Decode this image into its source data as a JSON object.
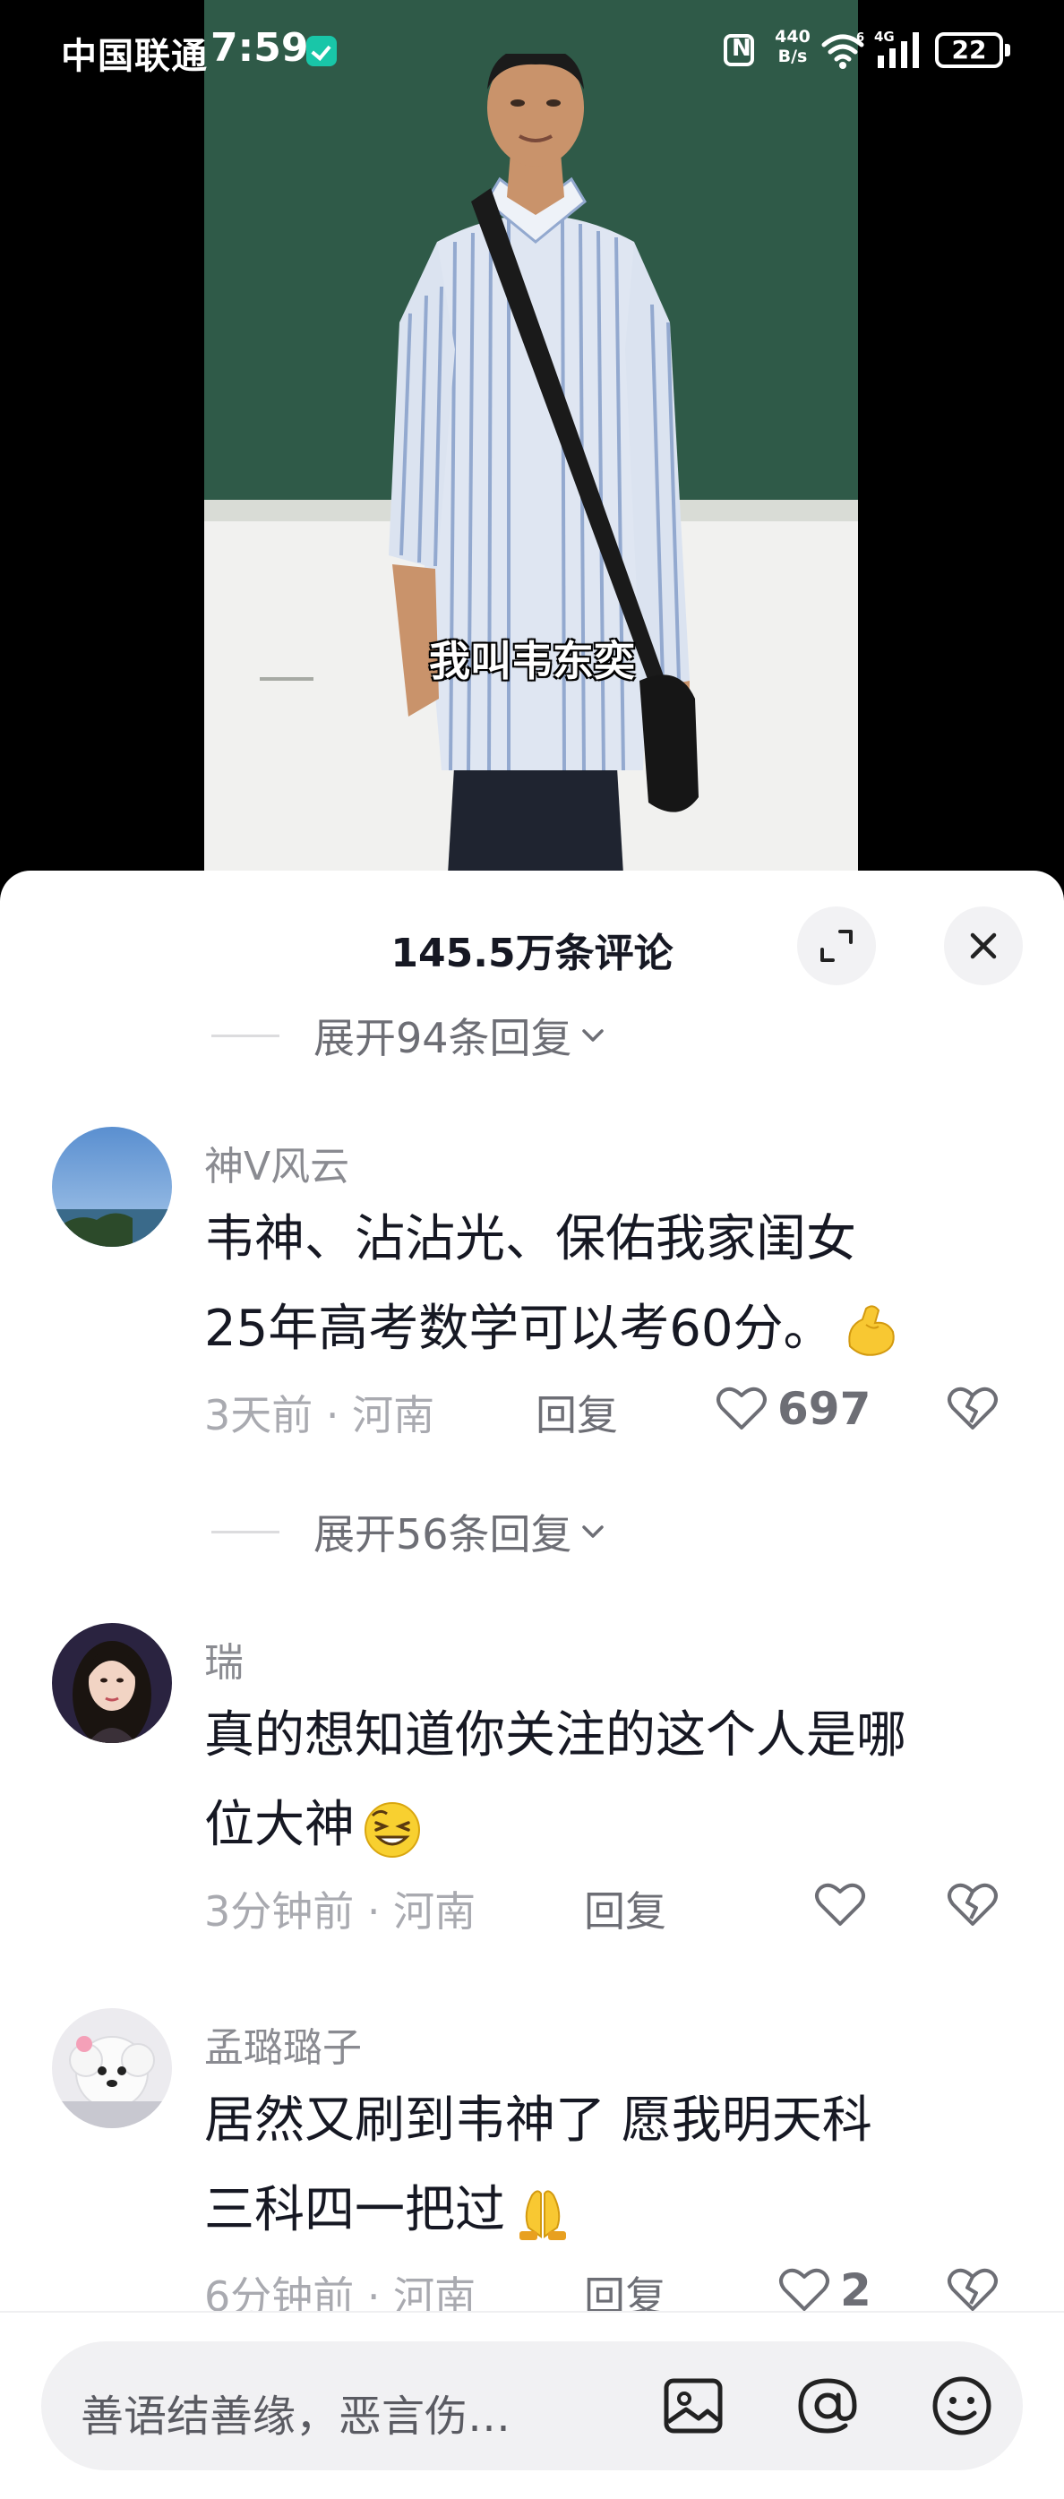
{
  "status_bar": {
    "carrier": "中国联通",
    "time": "7:59",
    "net_speed_value": "440",
    "net_speed_unit": "B/s",
    "wifi_label": "6",
    "signal_label": "4G",
    "battery": "22"
  },
  "video": {
    "caption": "我叫韦东奕"
  },
  "sheet": {
    "title": "145.5万条评论"
  },
  "replies_toggles": [
    {
      "label": "展开94条回复"
    },
    {
      "label": "展开56条回复"
    }
  ],
  "comments": [
    {
      "username": "神V风云",
      "line1": "韦神、沾沾光、保佑我家闺女",
      "line2": "25年高考数学可以考60分。",
      "emoji": "flexed-biceps",
      "time_location": "3天前 · 河南",
      "reply_label": "回复",
      "likes": "697"
    },
    {
      "username": "瑞",
      "line1": "真的想知道你关注的这个人是哪",
      "line2": "位大神",
      "emoji": "squinting-smile",
      "time_location": "3分钟前 · 河南",
      "reply_label": "回复",
      "likes": ""
    },
    {
      "username": "孟璐璐子",
      "line1": "居然又刷到韦神了 愿我明天科",
      "line2": "三科四一把过",
      "emoji": "folded-hands",
      "time_location": "6分钟前 · 河南",
      "reply_label": "回复",
      "likes": "2"
    }
  ],
  "input": {
    "placeholder": "善语结善缘，恶言伤…"
  },
  "colors": {
    "chalkboard": "#2f5a48",
    "text_primary": "#161823",
    "text_secondary": "#8a8b91"
  }
}
